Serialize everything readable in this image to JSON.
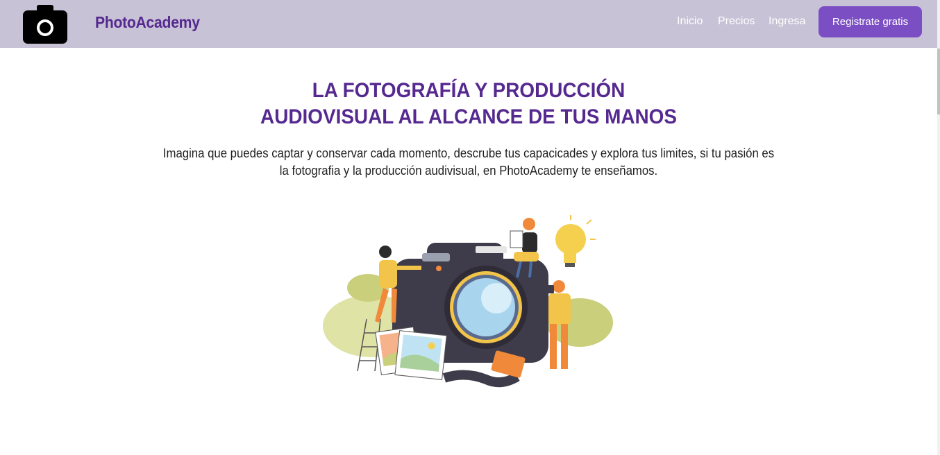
{
  "navbar": {
    "logo_icon": "camera-icon",
    "brand": "PhotoAcademy",
    "links": [
      "Inicio",
      "Precios",
      "Ingresa"
    ],
    "cta_label": "Registrate gratis"
  },
  "hero": {
    "title_line1": "LA FOTOGRAFÍA Y PRODUCCIÓN",
    "title_line2": "AUDIOVISUAL AL ALCANCE DE TUS MANOS",
    "description": "Imagina que puedes captar y conservar cada momento, descrube tus capacicades y explora tus limites, si tu pasión es la fotografia y la producción audivisual, en PhotoAcademy te enseñamos.",
    "illustration": "camera-with-photographers-illustration"
  },
  "colors": {
    "navbar_bg": "#c8c2d6",
    "brand": "#55298f",
    "cta_bg": "#7c4ec4"
  }
}
